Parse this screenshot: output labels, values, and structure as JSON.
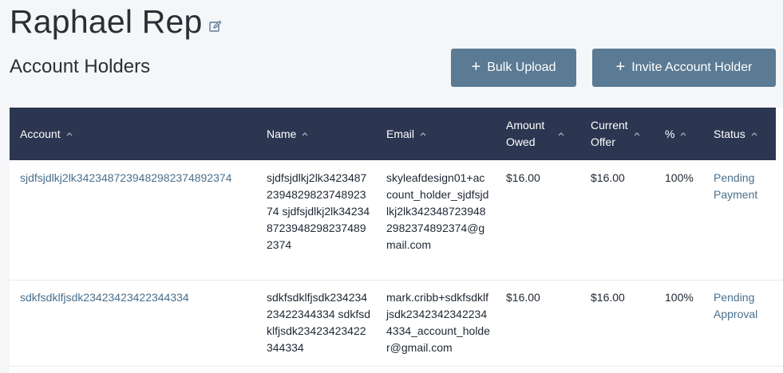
{
  "page": {
    "title": "Raphael Rep",
    "section_title": "Account Holders"
  },
  "toolbar": {
    "bulk_upload_label": "Bulk Upload",
    "invite_label": "Invite Account Holder",
    "plus_glyph": "+"
  },
  "table": {
    "columns": [
      {
        "label": "Account",
        "line2": ""
      },
      {
        "label": "Name",
        "line2": ""
      },
      {
        "label": "Email",
        "line2": ""
      },
      {
        "label": "Amount",
        "line2": "Owed"
      },
      {
        "label": "Current",
        "line2": "Offer"
      },
      {
        "label": "%",
        "line2": ""
      },
      {
        "label": "Status",
        "line2": ""
      }
    ],
    "rows": [
      {
        "account": "sjdfsjdlkj2lk342348723948298237489 2374",
        "account_display": "sjdfsjdlkj2lk342348723948298237489 2374",
        "name": "sjdfsjdlkj2lk342348723948298237489 2374 sjdfsjdlkj2lk342348723948298237489 2374",
        "email": "skyleafdesign01+account_holder_sjdfsjdlkj2lk342348723948298237489 2374@gmail.com",
        "amount_owed": "$16.00",
        "current_offer": "$16.00",
        "percent": "100%",
        "status": "Pending Payment"
      },
      {
        "account": "sdkfsdklfjsdk23423423422344334",
        "name": "sdkfsdklfjsdk23423423422344334 sdkfsdklfjsdk23423423422344334",
        "email": "mark.cribb+sdkfsdklfjsdk23423423422344334_account_holder@gmail.com",
        "amount_owed": "$16.00",
        "current_offer": "$16.00",
        "percent": "100%",
        "status": "Pending Approval"
      }
    ]
  },
  "icons": {
    "edit": "edit-icon",
    "sort": "chevron-up-icon",
    "plus": "plus-icon"
  },
  "colors": {
    "header_bg": "#2c3650",
    "button_bg": "#5b7a93",
    "link": "#4a6f8c",
    "page_bg": "#f4f6f8"
  }
}
